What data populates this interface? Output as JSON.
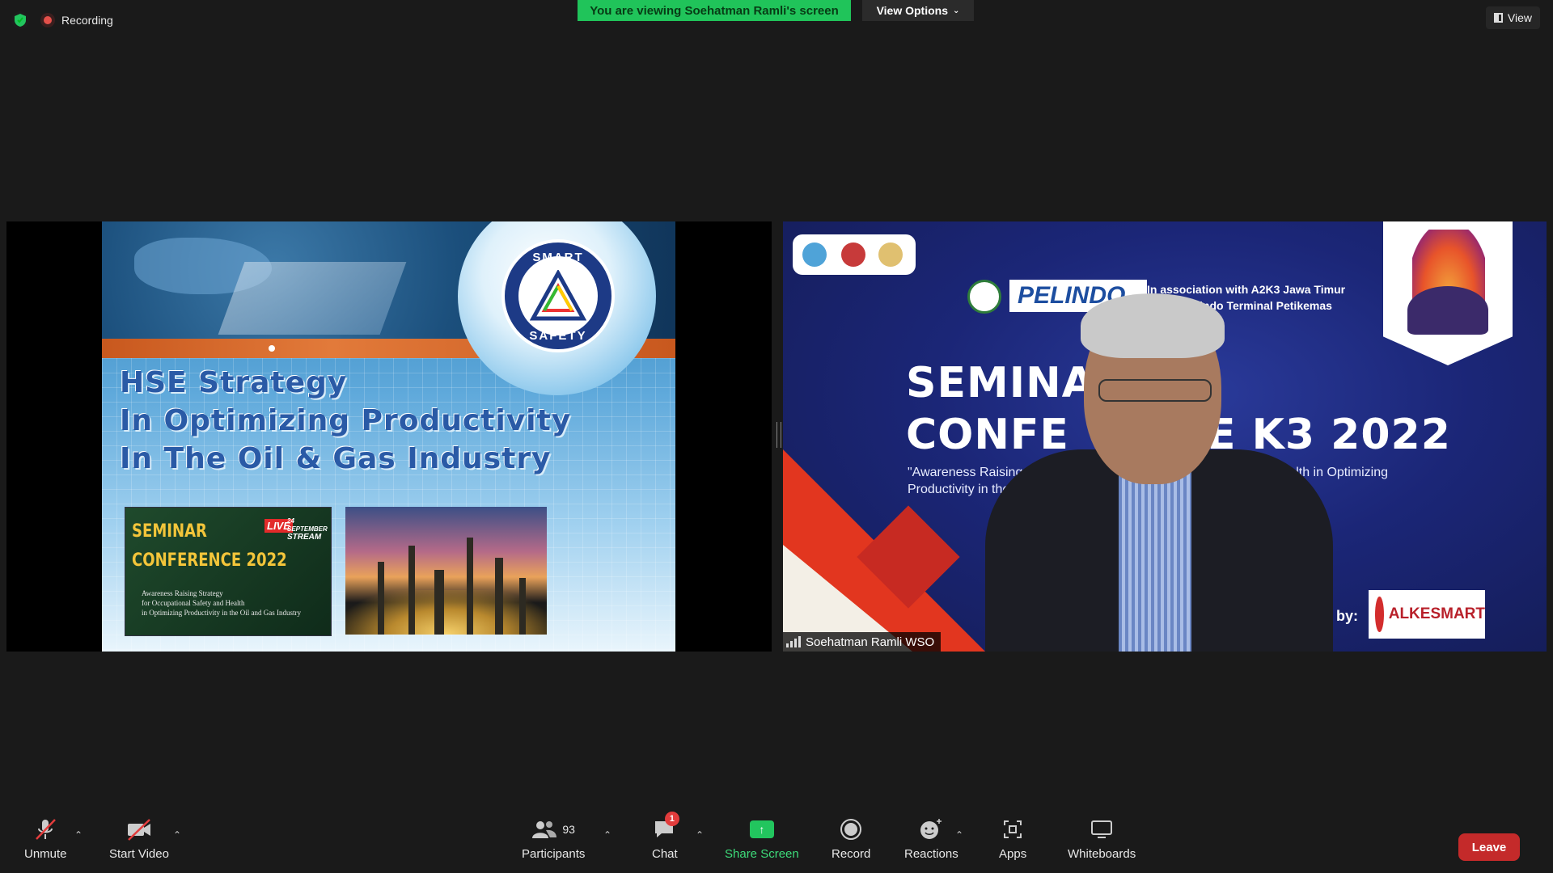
{
  "meeting": {
    "recording_label": "Recording",
    "viewing_banner": "You are viewing Soehatman Ramli's screen",
    "view_options_label": "View Options",
    "view_label": "View"
  },
  "shared_slide": {
    "logo_top": "SMART",
    "logo_bottom": "SAFETY",
    "title_lines": [
      "HSE Strategy",
      "In Optimizing Productivity",
      "In The Oil & Gas Industry"
    ],
    "poster_title_1": "SEMINAR",
    "poster_title_2": "CONFERENCE 2022",
    "poster_live": "LIVE",
    "poster_date": "24 SEPTEMBER",
    "poster_stream": "STREAM",
    "poster_sub_lines": [
      "Awareness Raising Strategy",
      "for Occupational Safety and Health",
      "in Optimizing Productivity in the Oil and Gas Industry"
    ]
  },
  "speaker_video": {
    "name": "Soehatman Ramli WSO",
    "bg_pelindo": "PELINDO",
    "bg_assoc_lines": [
      "In association with A2K3 Jawa Timur",
      "& Pelindo Terminal Petikemas"
    ],
    "bg_title_1": "SEMINA",
    "bg_title_2": "CONFE",
    "bg_title_2b": "E K3 2022",
    "bg_quote_1": "\"Awareness Raising Strate",
    "bg_quote_1b": "fety and Health in Optimizing",
    "bg_quote_2": "Productivity in the Oi",
    "bg_by": "by:",
    "bg_sponsor": "ALKESMART"
  },
  "toolbar": {
    "unmute": "Unmute",
    "start_video": "Start Video",
    "participants": "Participants",
    "participants_count": "93",
    "chat": "Chat",
    "chat_badge": "1",
    "share_screen": "Share Screen",
    "record": "Record",
    "reactions": "Reactions",
    "apps": "Apps",
    "whiteboards": "Whiteboards",
    "leave": "Leave"
  },
  "colors": {
    "viewing_banner": "#20c45a",
    "leave": "#c42a2a",
    "share": "#22c55e",
    "recording_dot": "#e5504a"
  }
}
